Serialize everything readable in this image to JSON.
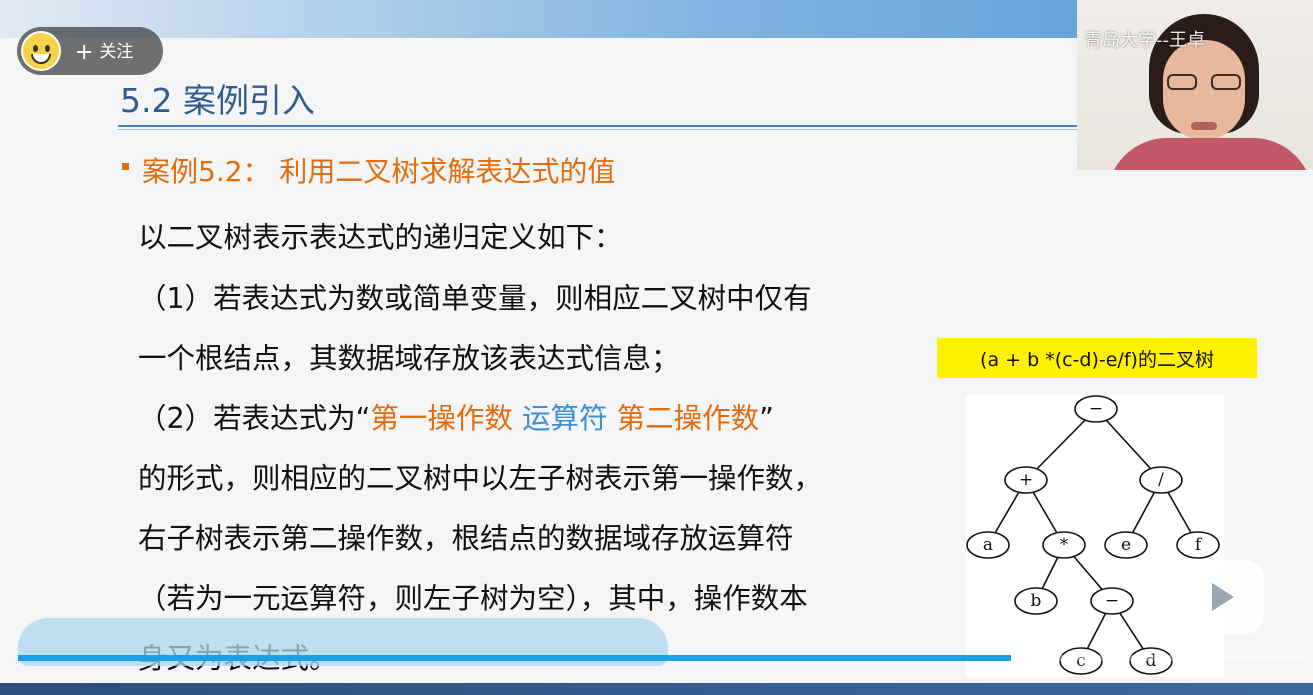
{
  "follow": {
    "label": "关注",
    "plus": "+"
  },
  "slide": {
    "title": "5.2 案例引入",
    "case_label": "案例5.2：  利用二叉树求解表达式的值",
    "lines": [
      "以二叉树表示表达式的递归定义如下：",
      "（1）若表达式为数或简单变量，则相应二叉树中仅有",
      "一个根结点，其数据域存放该表达式信息；",
      "的形式，则相应的二叉树中以左子树表示第一操作数，",
      "右子树表示第二操作数，根结点的数据域存放运算符",
      "（若为一元运算符，则左子树为空），其中，操作数本",
      "身又为表达式。"
    ],
    "line2": {
      "prefix": "（2）若表达式为“",
      "first_operand": "第一操作数",
      "operator": "运算符",
      "second_operand": "第二操作数",
      "suffix": "”"
    }
  },
  "diagram": {
    "caption": "(a + b *(c-d)-e/f)的二叉树",
    "nodes": {
      "root": "−",
      "plus": "+",
      "div": "/",
      "a": "a",
      "mul": "*",
      "e": "e",
      "f": "f",
      "b": "b",
      "minus": "−",
      "c": "c",
      "d": "d"
    }
  },
  "video": {
    "watermark": "青岛大学--王卓",
    "progress": 0.77
  },
  "colors": {
    "title": "#2f5e8c",
    "accent_orange": "#e46c0a",
    "accent_blue": "#3f8ed4",
    "caption_bg": "#fff100",
    "progress": "#1aa0e6"
  }
}
